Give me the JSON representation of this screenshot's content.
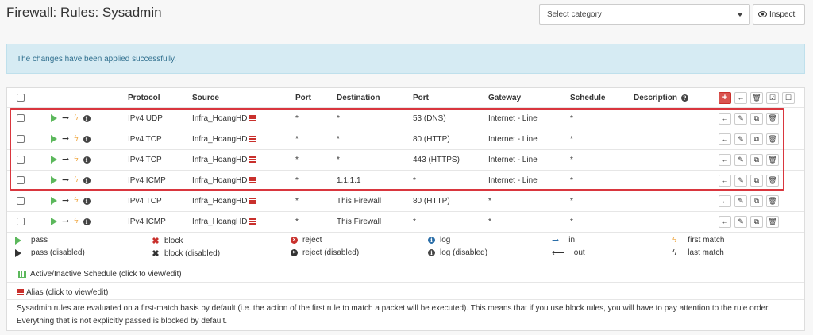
{
  "page": {
    "title": "Firewall: Rules: Sysadmin"
  },
  "toolbar": {
    "category_placeholder": "Select category",
    "inspect_label": "Inspect"
  },
  "alert": {
    "message": "The changes have been applied successfully."
  },
  "table": {
    "headers": {
      "protocol": "Protocol",
      "source": "Source",
      "port": "Port",
      "destination": "Destination",
      "dest_port": "Port",
      "gateway": "Gateway",
      "schedule": "Schedule",
      "description": "Description"
    },
    "rows": [
      {
        "protocol": "IPv4 UDP",
        "source": "Infra_HoangHD",
        "port": "*",
        "destination": "*",
        "dest_port": "53 (DNS)",
        "gateway": "Internet - Line",
        "schedule": "*"
      },
      {
        "protocol": "IPv4 TCP",
        "source": "Infra_HoangHD",
        "port": "*",
        "destination": "*",
        "dest_port": "80 (HTTP)",
        "gateway": "Internet - Line",
        "schedule": "*"
      },
      {
        "protocol": "IPv4 TCP",
        "source": "Infra_HoangHD",
        "port": "*",
        "destination": "*",
        "dest_port": "443 (HTTPS)",
        "gateway": "Internet - Line",
        "schedule": "*"
      },
      {
        "protocol": "IPv4 ICMP",
        "source": "Infra_HoangHD",
        "port": "*",
        "destination": "1.1.1.1",
        "dest_port": "*",
        "gateway": "Internet - Line",
        "schedule": "*"
      },
      {
        "protocol": "IPv4 TCP",
        "source": "Infra_HoangHD",
        "port": "*",
        "destination": "This Firewall",
        "dest_port": "80 (HTTP)",
        "gateway": "*",
        "schedule": "*"
      },
      {
        "protocol": "IPv4 ICMP",
        "source": "Infra_HoangHD",
        "port": "*",
        "destination": "This Firewall",
        "dest_port": "*",
        "gateway": "*",
        "schedule": "*"
      }
    ]
  },
  "legend": {
    "pass": "pass",
    "pass_disabled": "pass (disabled)",
    "block": "block",
    "block_disabled": "block (disabled)",
    "reject": "reject",
    "reject_disabled": "reject (disabled)",
    "log": "log",
    "log_disabled": "log (disabled)",
    "in": "in",
    "out": "out",
    "first_match": "first match",
    "last_match": "last match"
  },
  "notes": {
    "schedule": "Active/Inactive Schedule (click to view/edit)",
    "alias": "Alias (click to view/edit)",
    "footer": "Sysadmin rules are evaluated on a first-match basis by default (i.e. the action of the first rule to match a packet will be executed). This means that if you use block rules, you will have to pay attention to the rule order. Everything that is not explicitly passed is blocked by default."
  },
  "colors": {
    "accent_red": "#d9363e",
    "pass_green": "#5cb85c",
    "alert_bg": "#d6ebf3",
    "alias_red": "#c9302c"
  }
}
